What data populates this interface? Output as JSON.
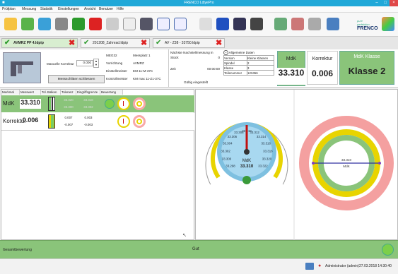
{
  "window": {
    "title": "FRENCO LdiyePro"
  },
  "menu": [
    "Prüfplan",
    "Messung",
    "Statistik",
    "Einstellungen",
    "Ansicht",
    "Benutzer",
    "Hilfe"
  ],
  "brand": {
    "name": "FRENCO",
    "tagline_1": "pure",
    "tagline_2": "perfektion"
  },
  "tabs": [
    {
      "label": "AVMRZ PP 4.ldpip",
      "active": true
    },
    {
      "label": "201208_Zahnrad.ldpip",
      "active": false
    },
    {
      "label": "AV - Z38 - 33750.ldpip",
      "active": false
    }
  ],
  "info": {
    "manual_correction_label": "Manuelle Korrektur",
    "manual_correction_value": "0.000",
    "slider_button": "Messschlitten schliessen",
    "grid": [
      [
        "MEG32",
        "Messplatz 1"
      ],
      [
        "Vorrichtung",
        "AVMRZ"
      ],
      [
        "Einstellmeister",
        "EM 11-M-37C"
      ],
      [
        "Kontrollmeister",
        "KM max 11-Z1-37C"
      ]
    ],
    "next_check_title": "Nächste Nachstellmessung in",
    "stueck_label": "Stück",
    "stueck_value": "0",
    "zeit_label": "Zeit",
    "zeit_value": "00:00:00",
    "gueltig": "Gültig eingestellt",
    "allg_title": "Allgemeine Daten",
    "allg": [
      [
        "Version",
        "Kleine Klassen"
      ],
      [
        "Spindel",
        "2"
      ],
      [
        "Klasse",
        "3"
      ],
      [
        "Teilenummer",
        "123456"
      ]
    ],
    "mdk_header": "MdK",
    "korrektur_header": "Korrektur",
    "mdk_klasse_header": "MdK Klasse",
    "mdk_value": "33.310",
    "korrektur_value": "0.006",
    "klasse_value": "Klasse 2"
  },
  "table": {
    "headers": [
      "Merkmal",
      "Messwert",
      "Tol. Balken",
      "Toleranz",
      "Eingriffsgrenze",
      "Bewertung"
    ],
    "rows": [
      {
        "name": "MdK",
        "value": "33.310",
        "tol_hi": "33.320",
        "tol_lo": "33.300",
        "eg_hi": "33.318",
        "eg_lo": "33.302"
      },
      {
        "name": "Korrektur",
        "value": "0.006",
        "tol_hi": "0.007",
        "tol_lo": "-0.007",
        "eg_hi": "0.003",
        "eg_lo": "-0.003"
      }
    ]
  },
  "gauge": {
    "ticks": [
      "33.298",
      "33.300",
      "33.302",
      "33.304",
      "33.306",
      "33.308",
      "33.310",
      "33.312",
      "33.314",
      "33.316",
      "33.318",
      "33.320",
      "33.322"
    ],
    "label": "MdK",
    "value": "33.310",
    "needle_fraction": 0.5
  },
  "ring": {
    "value": "33.310",
    "label": "MdK"
  },
  "status": {
    "overall_label": "Gesamtbewertung",
    "overall_value": "Gut",
    "user": "Administrator (admin)",
    "datetime": "27.03.2018 14:30:40"
  },
  "colors": {
    "accent": "#20a8d8",
    "good": "#8ac47a",
    "warn": "#e8d400",
    "bad": "#e04848"
  }
}
